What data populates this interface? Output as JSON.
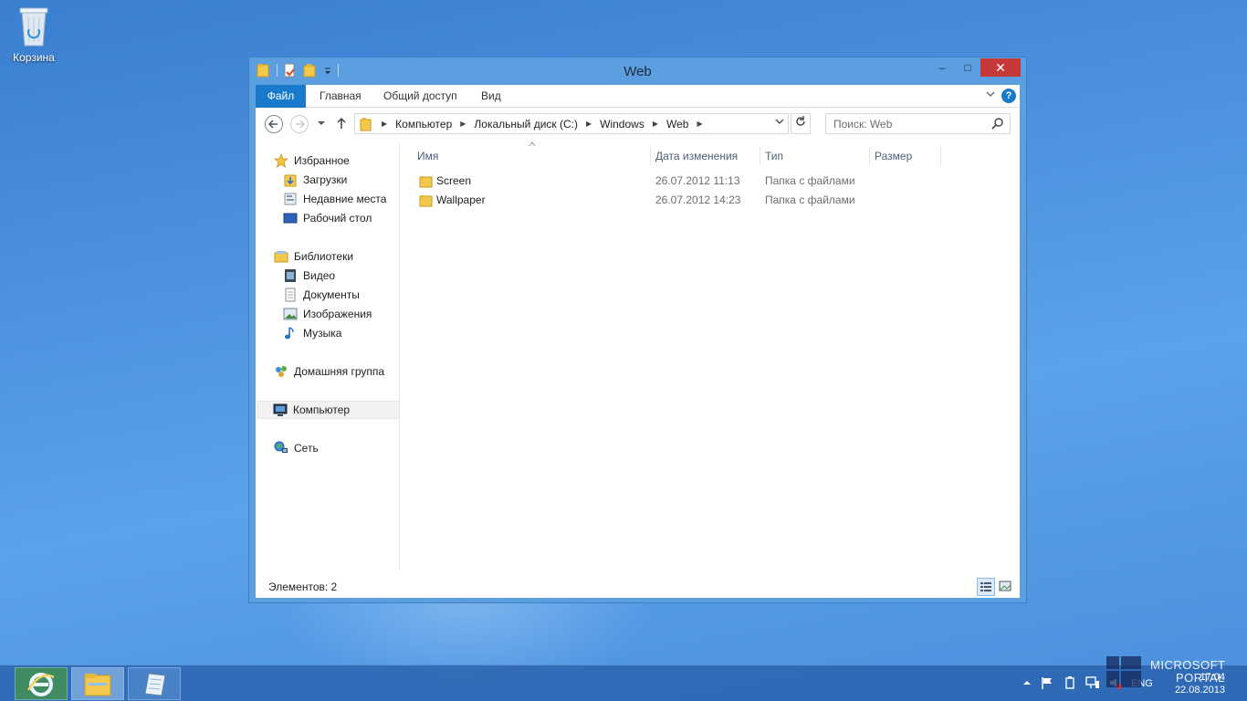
{
  "desktop": {
    "recycle_bin_label": "Корзина"
  },
  "window": {
    "title": "Web",
    "controls": {
      "minimize": "–",
      "maximize": "□",
      "close": "✕"
    }
  },
  "ribbon": {
    "tabs": [
      {
        "label": "Файл"
      },
      {
        "label": "Главная"
      },
      {
        "label": "Общий доступ"
      },
      {
        "label": "Вид"
      }
    ],
    "help": "?"
  },
  "address_bar": {
    "breadcrumbs": [
      "Компьютер",
      "Локальный диск (C:)",
      "Windows",
      "Web"
    ]
  },
  "search": {
    "placeholder": "Поиск: Web"
  },
  "nav_pane": {
    "favorites": {
      "label": "Избранное",
      "items": [
        {
          "label": "Загрузки",
          "icon": "downloads-icon"
        },
        {
          "label": "Недавние места",
          "icon": "recent-places-icon"
        },
        {
          "label": "Рабочий стол",
          "icon": "desktop-icon"
        }
      ]
    },
    "libraries": {
      "label": "Библиотеки",
      "items": [
        {
          "label": "Видео",
          "icon": "video-icon"
        },
        {
          "label": "Документы",
          "icon": "documents-icon"
        },
        {
          "label": "Изображения",
          "icon": "pictures-icon"
        },
        {
          "label": "Музыка",
          "icon": "music-icon"
        }
      ]
    },
    "homegroup": {
      "label": "Домашняя группа"
    },
    "computer": {
      "label": "Компьютер",
      "selected": true
    },
    "network": {
      "label": "Сеть"
    }
  },
  "file_list": {
    "columns": [
      "Имя",
      "Дата изменения",
      "Тип",
      "Размер"
    ],
    "rows": [
      {
        "name": "Screen",
        "date": "26.07.2012 11:13",
        "type": "Папка с файлами",
        "size": ""
      },
      {
        "name": "Wallpaper",
        "date": "26.07.2012 14:23",
        "type": "Папка с файлами",
        "size": ""
      }
    ]
  },
  "status_bar": {
    "item_count": "Элементов: 2"
  },
  "taskbar": {
    "pinned": [
      "internet-explorer-icon",
      "file-explorer-icon",
      "notepad-icon"
    ],
    "tray": {
      "language": "ENG"
    },
    "clock": {
      "time": "17:04",
      "date": "22.08.2013"
    }
  },
  "watermark": {
    "line1": "MICROSOFT",
    "line2": "PORTAL"
  },
  "colors": {
    "accent": "#1979ca",
    "window_frame": "#5c9fe0",
    "close_button": "#c7383a",
    "desktop": "#4d93e0"
  }
}
